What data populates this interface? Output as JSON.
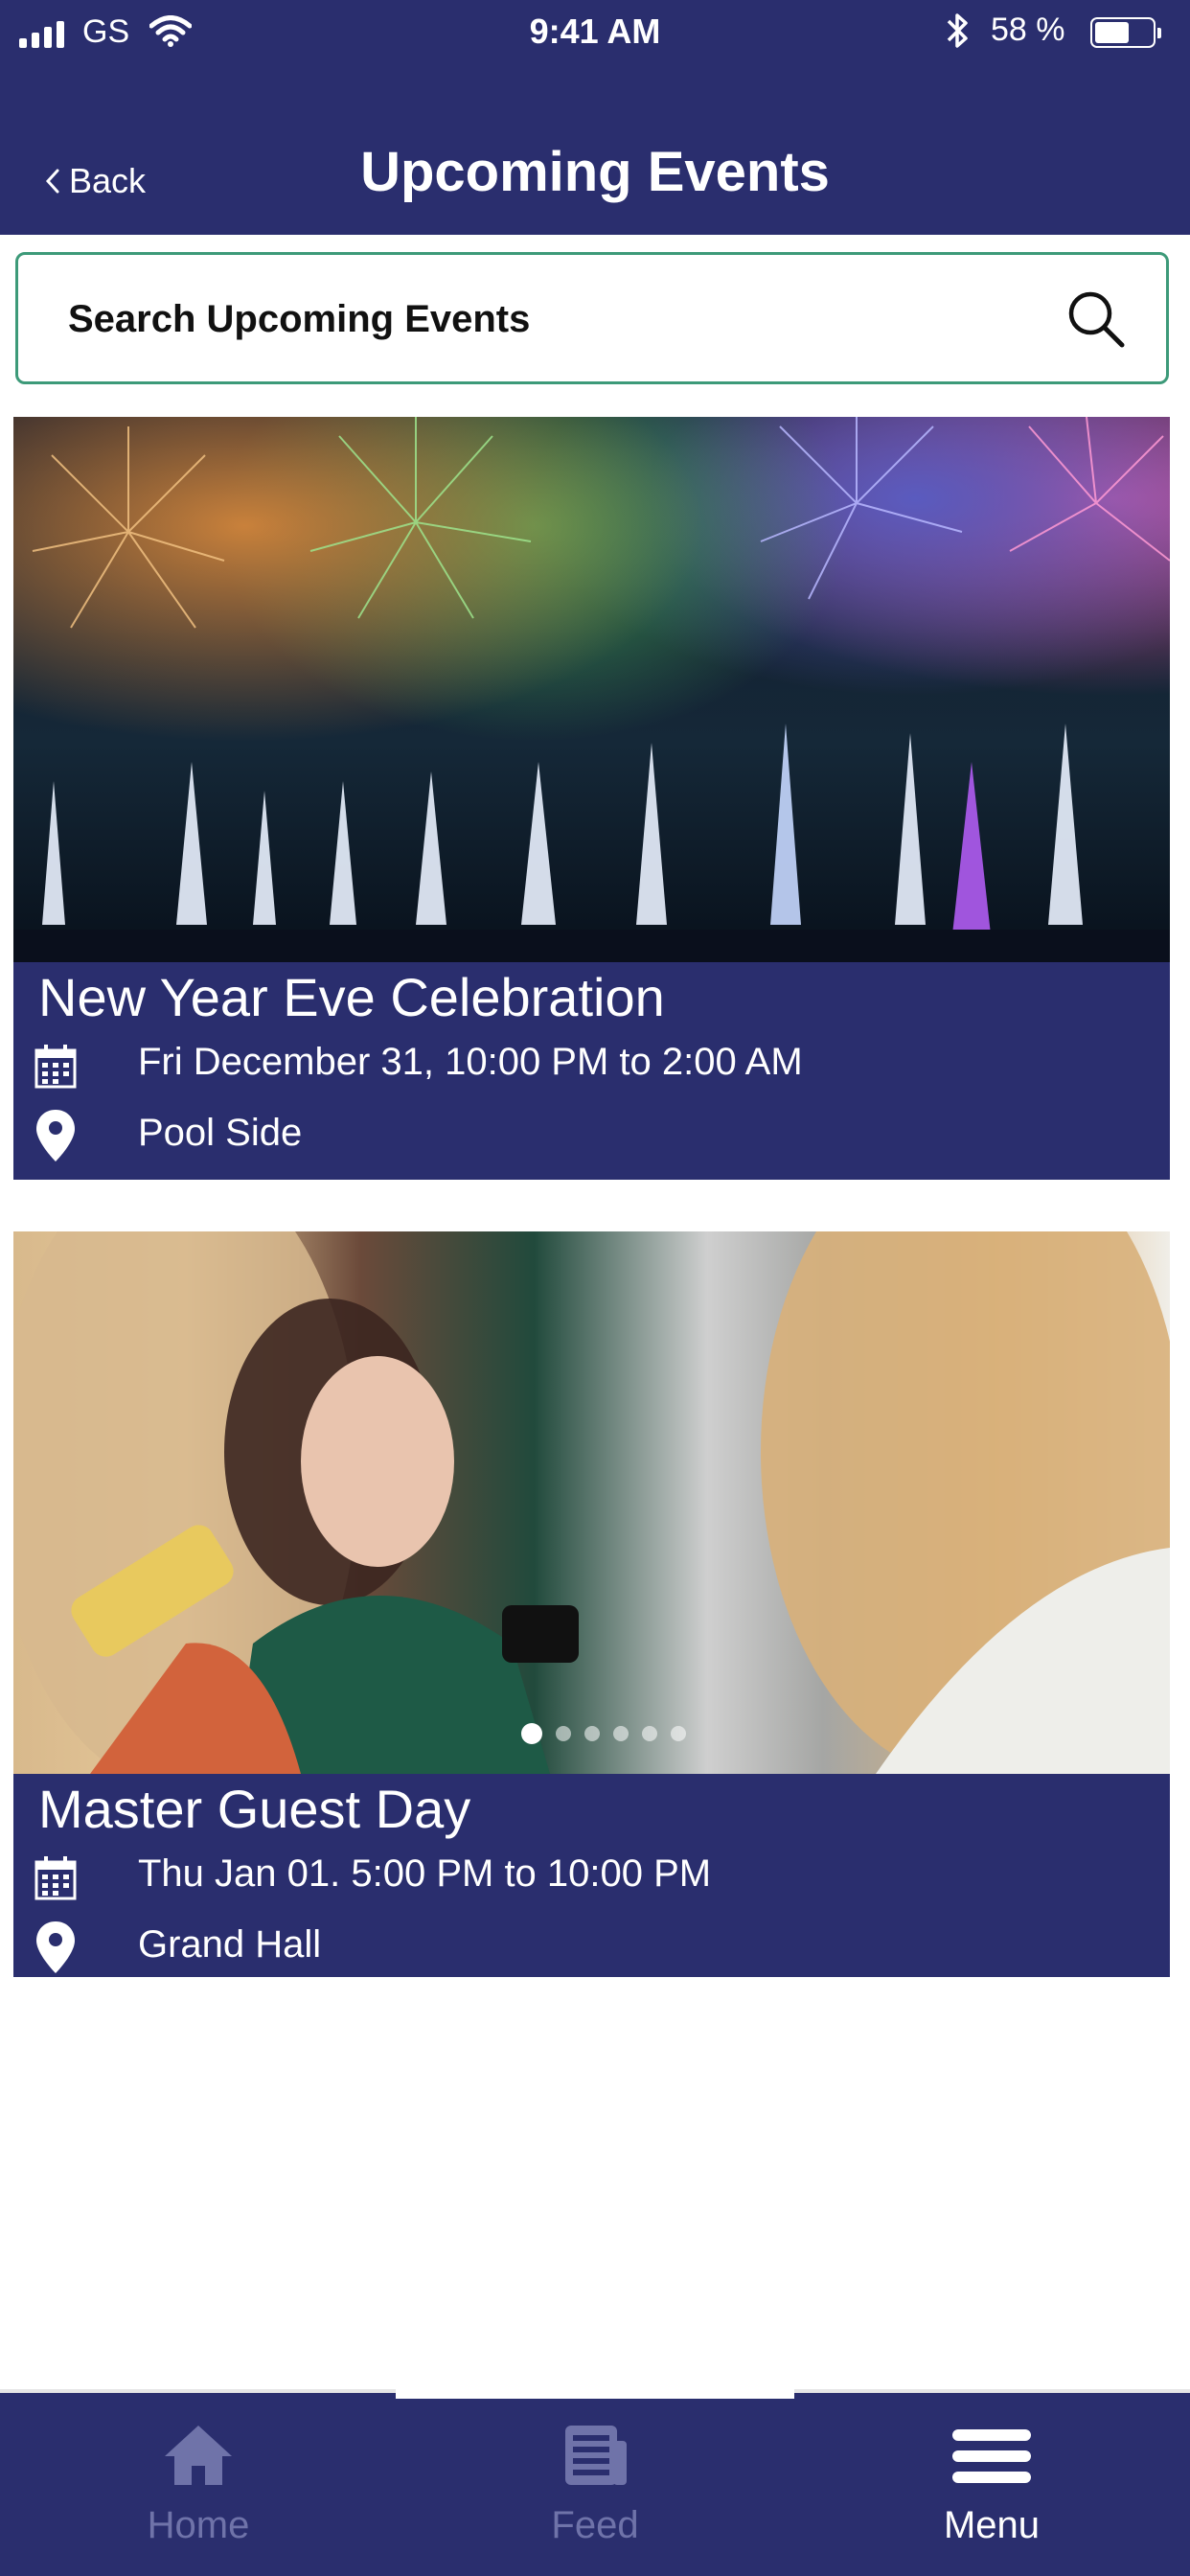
{
  "status_bar": {
    "carrier": "GS",
    "time": "9:41 AM",
    "battery_percent": "58 %",
    "battery_level": 0.58
  },
  "header": {
    "back_label": "Back",
    "title": "Upcoming Events"
  },
  "search": {
    "placeholder": "Search Upcoming Events"
  },
  "events": [
    {
      "name": "New Year Eve Celebration",
      "date": "Fri December 31, 10:00 PM to 2:00 AM",
      "location": "Pool Side",
      "image": "fireworks-over-water"
    },
    {
      "name": "Master Guest Day",
      "date": "Thu Jan 01. 5:00 PM to 10:00 PM",
      "location": "Grand Hall",
      "image": "women-looking-at-phone"
    }
  ],
  "carousel": {
    "total": 6,
    "active_index": 0
  },
  "tabbar": {
    "items": [
      {
        "label": "Home",
        "icon": "home-icon",
        "active": false
      },
      {
        "label": "Feed",
        "icon": "feed-icon",
        "active": false
      },
      {
        "label": "Menu",
        "icon": "menu-icon",
        "active": true
      }
    ]
  },
  "colors": {
    "primary": "#2a2e6e",
    "search_border": "#3d9a79",
    "inactive_tab": "#6f73a9"
  }
}
